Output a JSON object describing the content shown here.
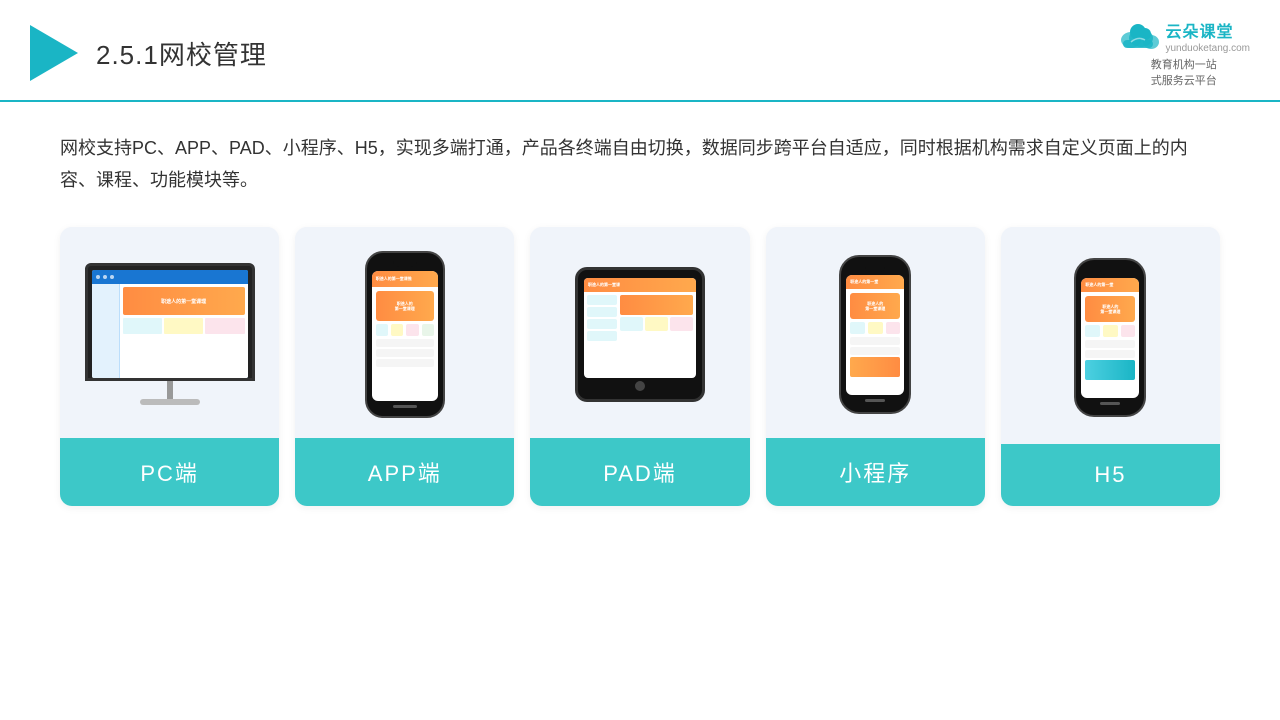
{
  "header": {
    "title_prefix": "2.5.1",
    "title_main": "网校管理",
    "brand_name": "云朵课堂",
    "brand_sub": "教育机构一站\n式服务云平台",
    "brand_url": "yunduoketang.com"
  },
  "description": "网校支持PC、APP、PAD、小程序、H5，实现多端打通，产品各终端自由切换，数据同步跨平台自适应，同时根据机构需求自定义页面上的内容、课程、功能模块等。",
  "cards": [
    {
      "id": "pc",
      "label": "PC端"
    },
    {
      "id": "app",
      "label": "APP端"
    },
    {
      "id": "pad",
      "label": "PAD端"
    },
    {
      "id": "miniprogram",
      "label": "小程序"
    },
    {
      "id": "h5",
      "label": "H5"
    }
  ],
  "colors": {
    "accent": "#1ab5c5",
    "card_bg": "#f0f4fa",
    "label_bg": "#3dc8c8",
    "header_line": "#1ab5c5"
  }
}
